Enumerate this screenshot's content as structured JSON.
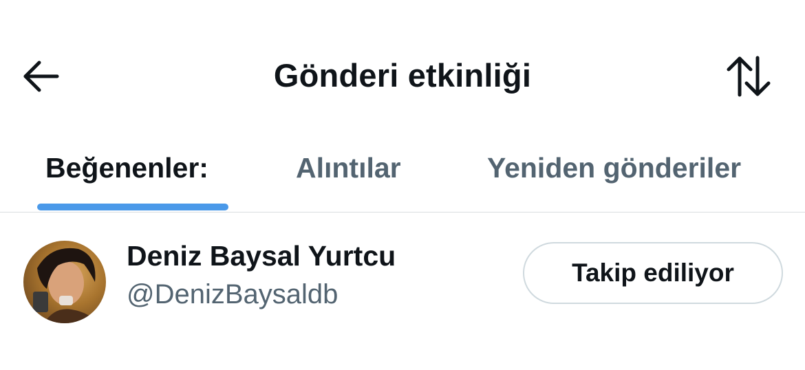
{
  "header": {
    "title": "Gönderi etkinliği",
    "back_icon": "arrow-left-icon",
    "sort_icon": "sort-arrows-icon"
  },
  "tabs": [
    {
      "label": "Beğenenler:",
      "active": true
    },
    {
      "label": "Alıntılar",
      "active": false
    },
    {
      "label": "Yeniden gönderiler",
      "active": false
    }
  ],
  "users": [
    {
      "name": "Deniz Baysal Yurtcu",
      "handle": "@DenizBaysaldb",
      "follow_label": "Takip ediliyor"
    }
  ],
  "colors": {
    "accent": "#4a99e9",
    "text_primary": "#0f1419",
    "text_secondary": "#536471",
    "border": "#cfd9de"
  }
}
